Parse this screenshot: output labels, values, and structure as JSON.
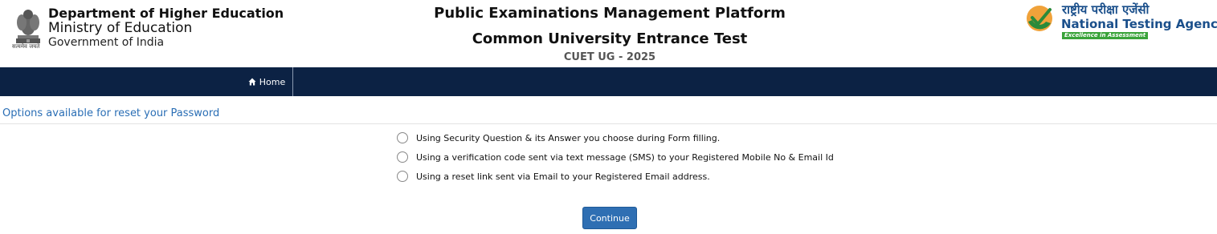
{
  "header": {
    "emblem_motto": "सत्यमेव जयते",
    "dept_line1": "Department of Higher Education",
    "dept_line2": "Ministry of Education",
    "dept_line3": "Government of India",
    "title1": "Public Examinations Management Platform",
    "title2": "Common University Entrance Test",
    "title3": "CUET UG - 2025",
    "nta_hindi": "राष्ट्रीय परीक्षा एजेंसी",
    "nta_english": "National Testing Agency",
    "nta_tagline": "Excellence in Assessment"
  },
  "nav": {
    "home_label": "Home"
  },
  "main": {
    "section_title": "Options available for reset your Password",
    "options": [
      {
        "label": "Using Security Question & its Answer you choose during Form filling."
      },
      {
        "label": "Using a verification code sent via text message (SMS) to your Registered Mobile No & Email Id"
      },
      {
        "label": "Using a reset link sent via Email to your Registered Email address."
      }
    ],
    "continue_label": "Continue"
  },
  "colors": {
    "navbar": "#0c2244",
    "accent_blue": "#2a6eb5",
    "button": "#2f6fb3",
    "nta_blue": "#1a4f8b",
    "nta_green": "#3aa33a"
  },
  "icons": {
    "emblem": "national-emblem-icon",
    "nta_logo": "nta-logo-icon",
    "home": "home-icon"
  }
}
